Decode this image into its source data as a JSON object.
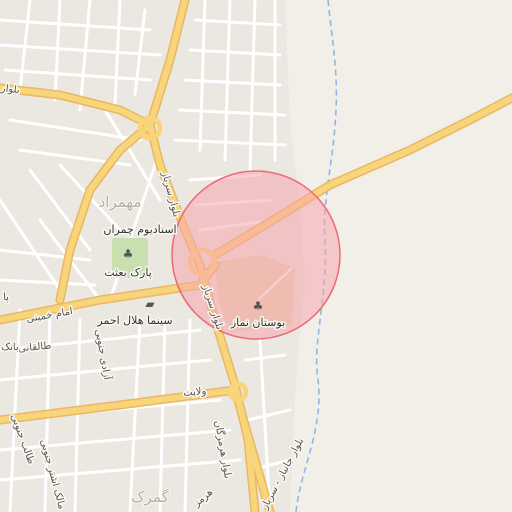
{
  "map": {
    "colors": {
      "background": "#f2efe9",
      "road_major": "#f8d57a",
      "road_minor": "#ffffff",
      "park": "#c8e0b0",
      "park_plaza": "#e2d8b4",
      "river": "#8fb7e6",
      "marker_fill": "#f7a6ad",
      "marker_stroke": "#ec6a76"
    },
    "labels": {
      "district_mehmarad": "مهمراد",
      "district_gomrok": "گمرک",
      "stadium": "استادیوم چمران",
      "park_behesht": "پارک بعثت",
      "cinema": "سینما هلال احمر",
      "park_namaz": "بوستان نماز",
      "blvd_sarbaz": "بلوار سرباز",
      "blvd_sarbaz_2": "بلوار سرباز",
      "blvd_top": "بلوار",
      "imam_khomeini": "امام خمینی",
      "taleghani": "طالقانی",
      "azadi_south": "آزادی جنوبی",
      "velayat": "ولایت",
      "blvd_hormozgan": "بلوار هرمزگان",
      "blvd_janbaz": "بلوار جانباز - سرباز",
      "bank": "بانک",
      "pa": "پا",
      "malek_ashtar": "مالک اشتر جنوبی",
      "taleb_south": "طالب جنوبی",
      "hormoz": "هرمز"
    },
    "icons": {
      "park_tree": "tree-icon",
      "cinema": "cinema-icon"
    }
  }
}
